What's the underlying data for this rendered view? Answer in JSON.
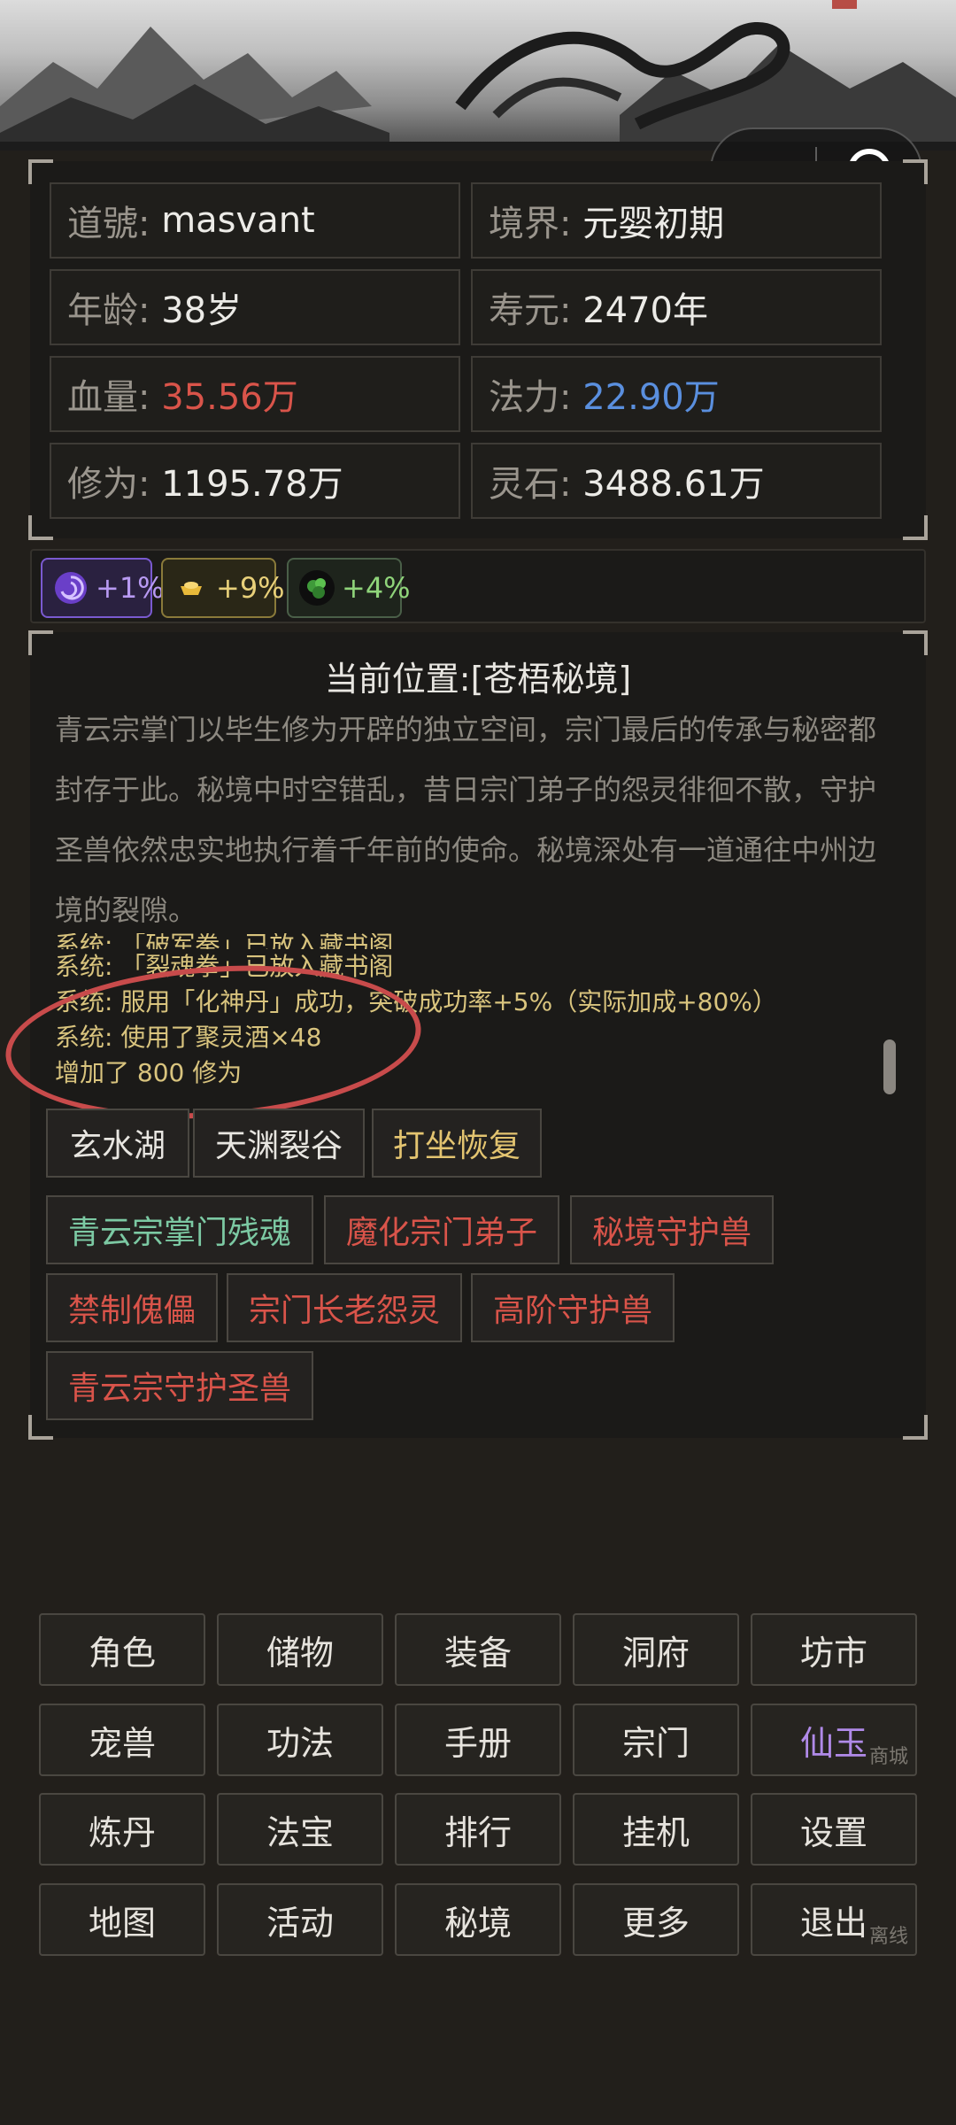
{
  "stats": [
    {
      "label": "道號:",
      "value": "masvant",
      "color": "white"
    },
    {
      "label": "境界:",
      "value": "元婴初期",
      "color": "white"
    },
    {
      "label": "年龄:",
      "value": "38岁",
      "color": "white"
    },
    {
      "label": "寿元:",
      "value": "2470年",
      "color": "white"
    },
    {
      "label": "血量:",
      "value": "35.56万",
      "color": "red"
    },
    {
      "label": "法力:",
      "value": "22.90万",
      "color": "blue"
    },
    {
      "label": "修为:",
      "value": "1195.78万",
      "color": "white"
    },
    {
      "label": "灵石:",
      "value": "3488.61万",
      "color": "white"
    }
  ],
  "buffs": [
    {
      "icon": "purple-orb-icon",
      "text": "+1%"
    },
    {
      "icon": "gold-ingot-icon",
      "text": "+9%"
    },
    {
      "icon": "green-herb-icon",
      "text": "+4%"
    }
  ],
  "location": {
    "title": "当前位置:[苍梧秘境]",
    "description": "青云宗掌门以毕生修为开辟的独立空间，宗门最后的传承与秘密都封存于此。秘境中时空错乱，昔日宗门弟子的怨灵徘徊不散，守护圣兽依然忠实地执行着千年前的使命。秘境深处有一道通往中州边境的裂隙。",
    "log_partial": "系统: 「破军拳」已放入藏书阁",
    "log": [
      "系统: 「裂魂拳」已放入藏书阁",
      "系统: 服用「化神丹」成功，突破成功率+5%（实际加成+80%）",
      "系统: 使用了聚灵酒×48",
      "增加了 800 修为"
    ],
    "exits": [
      {
        "label": "玄水湖",
        "style": "white"
      },
      {
        "label": "天渊裂谷",
        "style": "white"
      },
      {
        "label": "打坐恢复",
        "style": "gold"
      }
    ],
    "npcs": [
      {
        "label": "青云宗掌门残魂",
        "style": "green"
      },
      {
        "label": "魔化宗门弟子",
        "style": "red"
      },
      {
        "label": "秘境守护兽",
        "style": "red"
      },
      {
        "label": "禁制傀儡",
        "style": "red"
      },
      {
        "label": "宗门长老怨灵",
        "style": "red"
      },
      {
        "label": "高阶守护兽",
        "style": "red"
      },
      {
        "label": "青云宗守护圣兽",
        "style": "red"
      }
    ]
  },
  "menu": [
    {
      "label": "角色"
    },
    {
      "label": "储物"
    },
    {
      "label": "装备"
    },
    {
      "label": "洞府"
    },
    {
      "label": "坊市"
    },
    {
      "label": "宠兽"
    },
    {
      "label": "功法"
    },
    {
      "label": "手册"
    },
    {
      "label": "宗门"
    },
    {
      "label": "仙玉",
      "sub": "商城",
      "style": "purple"
    },
    {
      "label": "炼丹"
    },
    {
      "label": "法宝"
    },
    {
      "label": "排行"
    },
    {
      "label": "挂机"
    },
    {
      "label": "设置"
    },
    {
      "label": "地图"
    },
    {
      "label": "活动"
    },
    {
      "label": "秘境"
    },
    {
      "label": "更多"
    },
    {
      "label": "退出",
      "sub": "离线"
    }
  ],
  "colors": {
    "background": "#221f1b",
    "hp_red": "#d9544a",
    "mp_blue": "#5a8fde",
    "log_gold": "#d9c47e",
    "npc_green": "#7cc9a3",
    "annotation_circle": "#c84b4b"
  }
}
